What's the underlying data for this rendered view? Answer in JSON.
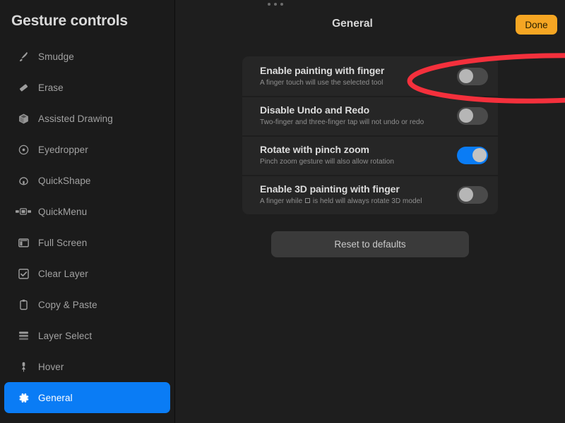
{
  "sidebar": {
    "title": "Gesture controls",
    "items": [
      {
        "label": "Smudge",
        "icon": "smudge-icon",
        "active": false
      },
      {
        "label": "Erase",
        "icon": "eraser-icon",
        "active": false
      },
      {
        "label": "Assisted Drawing",
        "icon": "cube-icon",
        "active": false
      },
      {
        "label": "Eyedropper",
        "icon": "eyedropper-icon",
        "active": false
      },
      {
        "label": "QuickShape",
        "icon": "quickshape-icon",
        "active": false
      },
      {
        "label": "QuickMenu",
        "icon": "quickmenu-icon",
        "active": false
      },
      {
        "label": "Full Screen",
        "icon": "fullscreen-icon",
        "active": false
      },
      {
        "label": "Clear Layer",
        "icon": "checkbox-icon",
        "active": false
      },
      {
        "label": "Copy & Paste",
        "icon": "clipboard-icon",
        "active": false
      },
      {
        "label": "Layer Select",
        "icon": "layers-icon",
        "active": false
      },
      {
        "label": "Hover",
        "icon": "hover-pin-icon",
        "active": false
      },
      {
        "label": "General",
        "icon": "gear-icon",
        "active": true
      }
    ]
  },
  "header": {
    "grabber_icon": "three-dots-handle-icon",
    "title": "General",
    "done_label": "Done"
  },
  "settings": {
    "rows": [
      {
        "title": "Enable painting with finger",
        "subtitle": "A finger touch will use the selected tool",
        "toggle_state": "off",
        "highlighted": true
      },
      {
        "title": "Disable Undo and Redo",
        "subtitle": "Two-finger and three-finger tap will not undo or redo",
        "toggle_state": "off",
        "highlighted": false
      },
      {
        "title": "Rotate with pinch zoom",
        "subtitle": "Pinch zoom gesture will also allow rotation",
        "toggle_state": "on",
        "highlighted": false
      },
      {
        "title": "Enable 3D painting with finger",
        "subtitle_before": "A finger while",
        "subtitle_key": "□",
        "subtitle_after": "is held will always rotate 3D model",
        "subtitle": "A finger while □ is held will always rotate 3D model",
        "toggle_state": "off",
        "highlighted": false
      }
    ],
    "reset_label": "Reset to defaults"
  },
  "annotation": {
    "shape": "red-ellipse-highlight",
    "color": "#f4303c",
    "targets": "Enable painting with finger"
  },
  "colors": {
    "accent_blue": "#0a7cf5",
    "done_orange": "#f5a623",
    "annotation_red": "#f4303c",
    "panel_bg": "#1e1e1e",
    "sidebar_bg": "#1b1b1b",
    "card_bg": "#262626"
  }
}
